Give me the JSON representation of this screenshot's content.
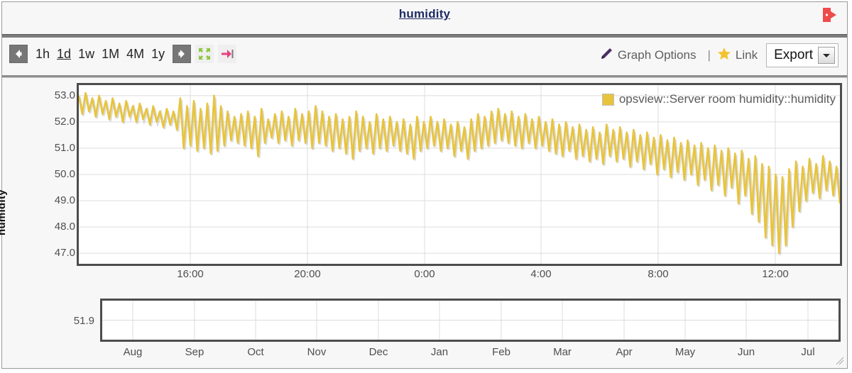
{
  "header": {
    "title": "humidity",
    "open_icon": "open-external-icon"
  },
  "toolbar": {
    "prev_icon": "arrow-left-icon",
    "next_icon": "arrow-right-icon",
    "fullscreen_icon": "fullscreen-expand-icon",
    "jump_end_icon": "jump-to-end-icon",
    "ranges": [
      {
        "label": "1h",
        "active": false
      },
      {
        "label": "1d",
        "active": true
      },
      {
        "label": "1w",
        "active": false
      },
      {
        "label": "1M",
        "active": false
      },
      {
        "label": "4M",
        "active": false
      },
      {
        "label": "1y",
        "active": false
      }
    ],
    "graph_options_icon": "pencil-icon",
    "graph_options_label": "Graph Options",
    "separator": "|",
    "link_icon": "star-icon",
    "link_label": "Link",
    "export_label": "Export",
    "export_arrow_icon": "chevron-down-icon"
  },
  "colors": {
    "series": "#e8c43d",
    "plot_border": "#4d4d4d",
    "grid": "#dcdcdc",
    "title": "#1d2a63",
    "panel_bg": "#f7f7f7",
    "open_icon": "#ef4b4b",
    "fullscreen_icon": "#8cc63f",
    "jump_icon": "#e8417f",
    "star_icon": "#f2c230",
    "pencil_icon": "#4b2e66"
  },
  "chart_data": {
    "type": "line",
    "title": "humidity",
    "xlabel": "",
    "ylabel": "humidity",
    "ylim": [
      46.6,
      53.4
    ],
    "yticks": [
      53.0,
      52.0,
      51.0,
      50.0,
      49.0,
      48.0,
      47.0
    ],
    "ytick_labels": [
      "53.0",
      "52.0",
      "51.0",
      "50.0",
      "49.0",
      "48.0",
      "47.0"
    ],
    "xticks": [
      "16:00",
      "20:00",
      "0:00",
      "4:00",
      "8:00",
      "12:00"
    ],
    "xlim": [
      "13:00",
      "12:30"
    ],
    "grid": true,
    "legend": {
      "position": "top-right",
      "entries": [
        "opsview::Server room humidity::humidity"
      ]
    },
    "series": [
      {
        "name": "opsview::Server room humidity::humidity",
        "color": "#e8c43d",
        "values": [
          53.0,
          52.3,
          53.1,
          52.4,
          52.9,
          52.2,
          53.0,
          52.3,
          52.8,
          52.1,
          52.9,
          52.2,
          52.7,
          52.0,
          52.8,
          52.2,
          52.6,
          52.0,
          52.7,
          52.1,
          52.5,
          51.9,
          52.6,
          52.0,
          52.4,
          51.8,
          52.5,
          51.9,
          52.4,
          51.7,
          52.9,
          51.0,
          52.6,
          51.1,
          52.8,
          50.9,
          52.5,
          51.0,
          52.7,
          50.8,
          53.0,
          50.9,
          52.6,
          51.1,
          52.4,
          51.3,
          52.2,
          51.2,
          52.3,
          51.1,
          52.4,
          51.0,
          52.2,
          50.7,
          52.5,
          51.2,
          52.1,
          51.4,
          52.3,
          51.2,
          52.4,
          51.3,
          52.2,
          51.1,
          52.5,
          51.3,
          52.3,
          51.2,
          52.4,
          51.0,
          52.6,
          51.2,
          52.4,
          51.1,
          52.2,
          50.9,
          52.3,
          51.0,
          52.1,
          50.8,
          52.2,
          50.6,
          52.4,
          50.9,
          52.2,
          51.0,
          52.0,
          50.8,
          52.3,
          51.0,
          52.1,
          50.9,
          52.2,
          51.1,
          52.0,
          50.9,
          52.1,
          50.8,
          51.9,
          50.6,
          52.2,
          50.9,
          52.0,
          51.0,
          52.2,
          51.1,
          52.0,
          50.9,
          52.1,
          51.0,
          51.9,
          50.7,
          52.0,
          50.9,
          51.8,
          50.6,
          52.1,
          50.9,
          52.3,
          51.0,
          52.2,
          51.1,
          52.4,
          51.2,
          52.5,
          51.3,
          52.3,
          51.2,
          52.4,
          51.1,
          52.2,
          51.0,
          52.3,
          51.2,
          52.1,
          51.0,
          52.2,
          51.1,
          52.0,
          50.9,
          52.1,
          50.8,
          51.9,
          50.7,
          52.0,
          50.9,
          51.8,
          50.6,
          51.9,
          50.7,
          51.7,
          50.5,
          51.8,
          50.6,
          51.6,
          50.4,
          51.9,
          50.7,
          51.7,
          50.5,
          51.8,
          50.6,
          51.6,
          50.3,
          51.7,
          50.5,
          51.5,
          50.2,
          51.6,
          50.4,
          51.4,
          50.0,
          51.5,
          50.2,
          51.3,
          49.9,
          51.4,
          50.1,
          51.2,
          49.8,
          51.3,
          50.0,
          51.1,
          49.6,
          51.2,
          49.8,
          51.0,
          49.4,
          51.1,
          49.6,
          50.9,
          49.2,
          51.0,
          49.5,
          50.8,
          48.9,
          50.9,
          49.2,
          50.6,
          48.5,
          50.7,
          48.2,
          50.4,
          47.6,
          50.3,
          47.3,
          50.0,
          47.0,
          49.9,
          47.3,
          50.2,
          48.0,
          50.5,
          48.6,
          50.3,
          49.0,
          50.6,
          49.3,
          50.4,
          49.1,
          50.7,
          49.4,
          50.5,
          49.2,
          50.3,
          48.9
        ]
      }
    ]
  },
  "overview": {
    "ytick_label": "51.9",
    "xticks": [
      "Aug",
      "Sep",
      "Oct",
      "Nov",
      "Dec",
      "Jan",
      "Feb",
      "Mar",
      "Apr",
      "May",
      "Jun",
      "Jul"
    ],
    "has_data": false,
    "resize_handle_icon": "resize-handle-icon"
  }
}
